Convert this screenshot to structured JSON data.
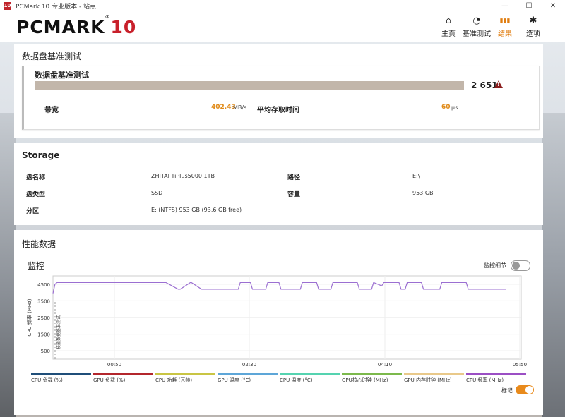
{
  "window": {
    "title": "PCMark 10 专业版本 - 站点",
    "minimize": "—",
    "maximize": "☐",
    "close": "✕"
  },
  "brand": {
    "logo_main": "PCMARK",
    "logo_num": "10",
    "reg": "®"
  },
  "nav": [
    {
      "label": "主页",
      "icon": "home-icon",
      "glyph": "⌂"
    },
    {
      "label": "基准测试",
      "icon": "gauge-icon",
      "glyph": "◔"
    },
    {
      "label": "结果",
      "icon": "bar-chart-icon",
      "glyph": "▮▮▮"
    },
    {
      "label": "选项",
      "icon": "gear-icon",
      "glyph": "✱"
    }
  ],
  "active_nav": "结果",
  "accent_color": "#e07d10",
  "benchmark": {
    "section_title": "数据盘基准测试",
    "card_title": "数据盘基准测试",
    "score": "2 651",
    "score_fraction": 1.0,
    "warning_glyph": "!",
    "bandwidth_label": "带宽",
    "bandwidth_value": "402.43",
    "bandwidth_unit": "MB/s",
    "latency_label": "平均存取时间",
    "latency_value": "60",
    "latency_unit": "μs"
  },
  "storage": {
    "title": "Storage",
    "rows": [
      {
        "label": "盘名称",
        "value": "ZHITAI TiPlus5000 1TB",
        "label2": "路径",
        "value2": "E:\\"
      },
      {
        "label": "盘类型",
        "value": "SSD",
        "label2": "容量",
        "value2": "953 GB"
      },
      {
        "label": "分区",
        "value": "E: (NTFS) 953 GB (93.6 GB free)"
      }
    ]
  },
  "performance": {
    "title": "性能数据",
    "monitor_label": "监控",
    "monitor_detail_label": "监控细节",
    "monitor_detail_on": false,
    "marker_label": "标记",
    "marker_on": true,
    "marker_text": "技能数据基准测试",
    "chart_data": {
      "type": "line",
      "ylabel": "CPU 频率 (MHz)",
      "yticks": [
        500,
        1500,
        2500,
        3500,
        4500
      ],
      "ylim": [
        0,
        5000
      ],
      "xticks": [
        "00:50",
        "02:30",
        "04:10",
        "05:50"
      ],
      "xlim": [
        0,
        350
      ],
      "grid": true,
      "series": [
        {
          "name": "CPU 频率 (MHz)",
          "color": "#9b6fd1",
          "x": [
            0,
            2,
            4,
            110,
            111,
            123,
            125,
            135,
            136,
            146,
            148,
            182,
            184,
            194,
            196,
            209,
            211,
            222,
            224,
            243,
            245,
            259,
            261,
            273,
            275,
            299,
            301,
            313,
            315,
            323,
            325,
            340,
            342,
            346,
            348,
            362,
            364,
            380,
            382,
            406,
            408,
            415,
            418,
            445
          ],
          "y": [
            3950,
            4500,
            4600,
            4600,
            4600,
            4200,
            4200,
            4600,
            4600,
            4200,
            4200,
            4200,
            4600,
            4600,
            4200,
            4200,
            4600,
            4600,
            4200,
            4200,
            4600,
            4600,
            4200,
            4200,
            4600,
            4600,
            4200,
            4200,
            4600,
            4400,
            4600,
            4600,
            4200,
            4200,
            4600,
            4600,
            4200,
            4200,
            4600,
            4600,
            4200,
            4200,
            4200,
            4200
          ]
        }
      ],
      "legend": [
        {
          "name": "CPU 负载 (%)",
          "color": "#1f4e79"
        },
        {
          "name": "GPU 负载 (%)",
          "color": "#b3262c"
        },
        {
          "name": "CPU 功耗 (瓦特)",
          "color": "#c9c544"
        },
        {
          "name": "GPU 温度 (°C)",
          "color": "#5da6d8"
        },
        {
          "name": "CPU 温度 (°C)",
          "color": "#55d3b0"
        },
        {
          "name": "GPU核心时钟 (MHz)",
          "color": "#7cb94c"
        },
        {
          "name": "GPU 内存时钟 (MHz)",
          "color": "#e9c98a"
        },
        {
          "name": "CPU 频率 (MHz)",
          "color": "#9b4fc4"
        }
      ]
    }
  }
}
